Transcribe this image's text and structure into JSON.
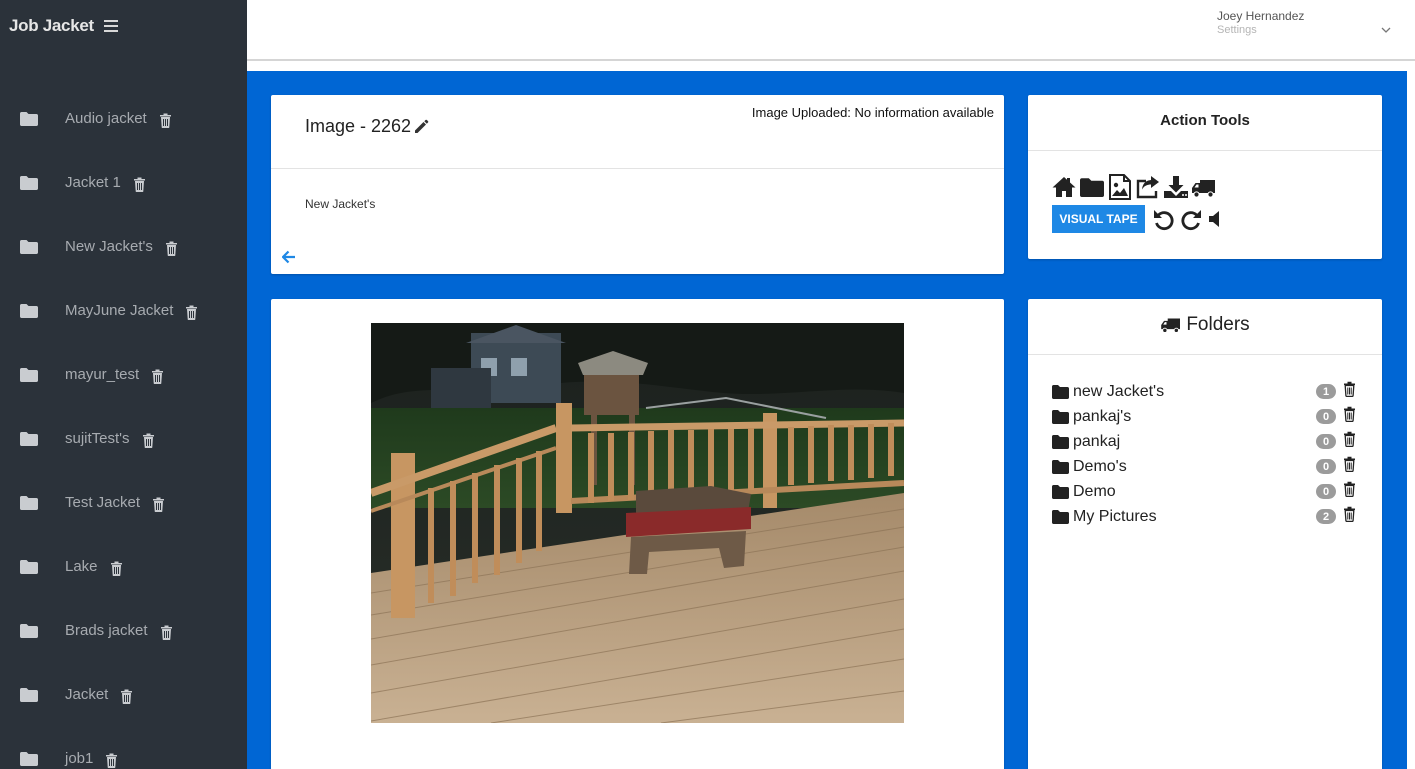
{
  "app": {
    "brand": "Job Jacket"
  },
  "user": {
    "name": "Joey Hernandez",
    "subtitle": "Settings"
  },
  "sidebar": {
    "items": [
      {
        "label": "Audio jacket"
      },
      {
        "label": "Jacket 1"
      },
      {
        "label": "New Jacket's"
      },
      {
        "label": "MayJune Jacket"
      },
      {
        "label": "mayur_test"
      },
      {
        "label": "sujitTest's"
      },
      {
        "label": "Test Jacket"
      },
      {
        "label": "Lake"
      },
      {
        "label": "Brads jacket"
      },
      {
        "label": "Jacket"
      },
      {
        "label": "job1"
      }
    ]
  },
  "image_header": {
    "title": "Image - 2262",
    "uploaded": "Image Uploaded: No information available",
    "jacket": "New Jacket's"
  },
  "action_tools": {
    "title": "Action Tools",
    "icons_row1": [
      "home-icon",
      "folder-icon",
      "image-icon",
      "share-icon",
      "download-icon",
      "truck-icon"
    ],
    "visual_tape_label": "VISUAL TAPE",
    "icons_row2": [
      "undo-icon",
      "redo-icon",
      "volume-icon"
    ]
  },
  "folders": {
    "title": "Folders",
    "items": [
      {
        "name": "new Jacket's",
        "count": "1"
      },
      {
        "name": "pankaj's",
        "count": "0"
      },
      {
        "name": "pankaj",
        "count": "0"
      },
      {
        "name": "Demo's",
        "count": "0"
      },
      {
        "name": "Demo",
        "count": "0"
      },
      {
        "name": "My Pictures",
        "count": "2"
      }
    ]
  },
  "colors": {
    "sidebar_bg": "#2b323a",
    "main_bg": "#0066d4",
    "accent": "#1e88e5",
    "badge": "#9b9b9b"
  }
}
